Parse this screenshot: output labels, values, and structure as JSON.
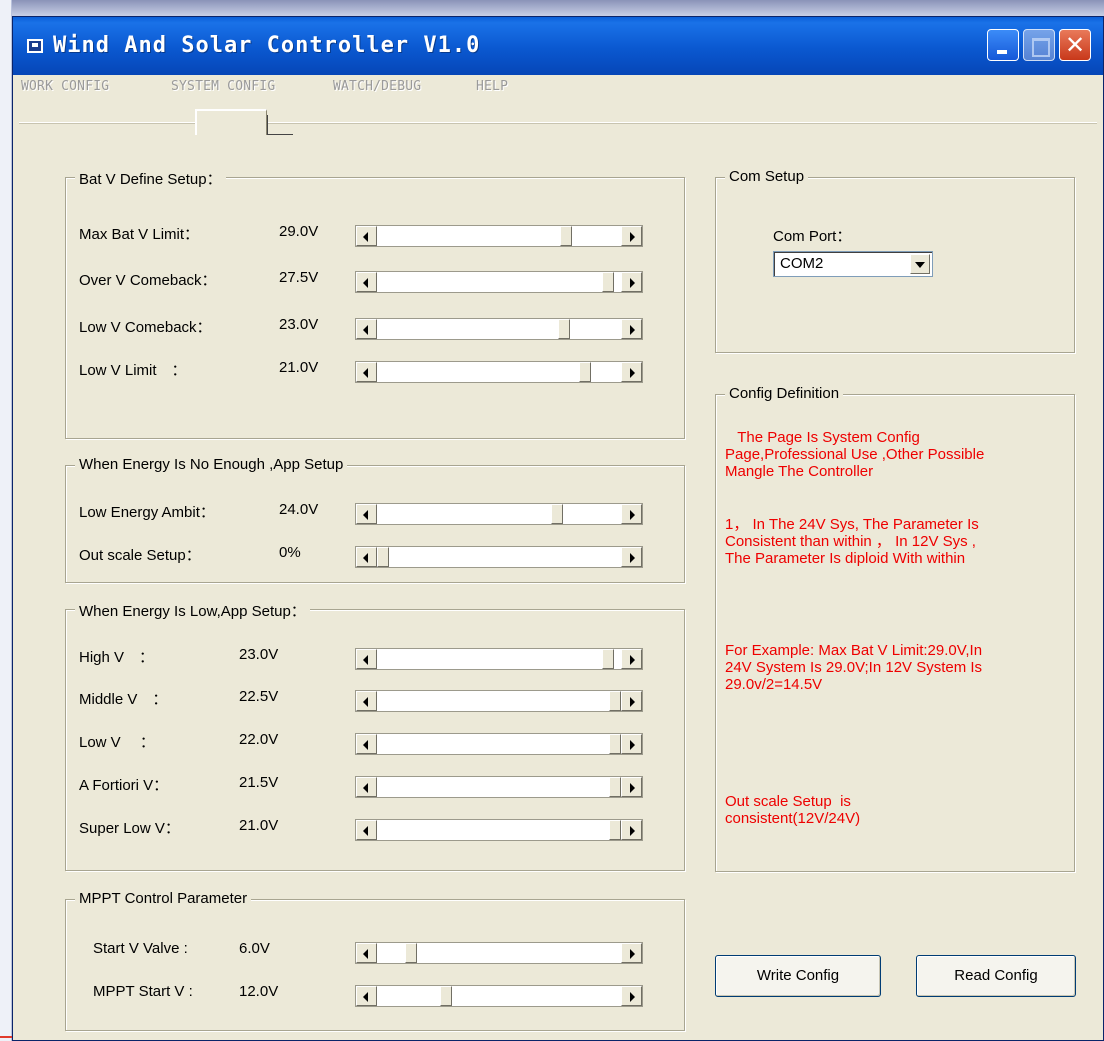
{
  "window": {
    "title": "Wind And Solar Controller V1.0",
    "close_glyph": "✕"
  },
  "menu": [
    "WORK CONFIG",
    "SYSTEM CONFIG",
    "WATCH/DEBUG",
    "HELP"
  ],
  "bat_v_define": {
    "title": "Bat V Define Setup：",
    "rows": [
      {
        "label": "Max Bat V Limit：",
        "value": "29.0V",
        "slider": 0.79
      },
      {
        "label": "Over V Comeback：",
        "value": "27.5V",
        "slider": 0.97
      },
      {
        "label": "Low V Comeback：",
        "value": "23.0V",
        "slider": 0.78
      },
      {
        "label": "Low V Limit　：",
        "value": "21.0V",
        "slider": 0.87
      }
    ]
  },
  "energy_no_enough": {
    "title": "When Energy Is No Enough ,App Setup",
    "rows": [
      {
        "label": "Low Energy Ambit：",
        "value": "24.0V",
        "slider": 0.75
      },
      {
        "label": "Out scale Setup：",
        "value": "0%",
        "slider": 0.0
      }
    ]
  },
  "energy_low": {
    "title": "When Energy Is Low,App Setup：",
    "rows": [
      {
        "label": "High V　：",
        "value": "23.0V",
        "slider": 0.97
      },
      {
        "label": "Middle V　：",
        "value": "22.5V",
        "slider": 1.0
      },
      {
        "label": "Low V　 ：",
        "value": "22.0V",
        "slider": 1.0
      },
      {
        "label": "A Fortiori V：",
        "value": "21.5V",
        "slider": 1.0
      },
      {
        "label": "Super Low V：",
        "value": "21.0V",
        "slider": 1.0
      }
    ]
  },
  "mppt": {
    "title": "MPPT Control  Parameter",
    "rows": [
      {
        "label": "Start V Valve :",
        "value": "6.0V",
        "slider": 0.12
      },
      {
        "label": "MPPT Start V :",
        "value": "12.0V",
        "slider": 0.27
      }
    ]
  },
  "com_setup": {
    "title": "Com Setup",
    "port_label": "Com Port：",
    "port_value": "COM2"
  },
  "config_definition": {
    "title": "Config Definition",
    "paragraphs": [
      "   The Page Is System Config\nPage,Professional Use ,Other Possible\nMangle The Controller",
      "1， In The 24V Sys, The Parameter Is\nConsistent than within ， In 12V Sys ,\nThe Parameter Is diploid With within",
      "For Example: Max Bat V Limit:29.0V,In\n24V System Is 29.0V;In 12V System Is\n29.0v/2=14.5V",
      "Out scale Setup  is\nconsistent(12V/24V)"
    ],
    "color": "#ee0000"
  },
  "buttons": {
    "write": "Write Config",
    "read": "Read Config"
  }
}
